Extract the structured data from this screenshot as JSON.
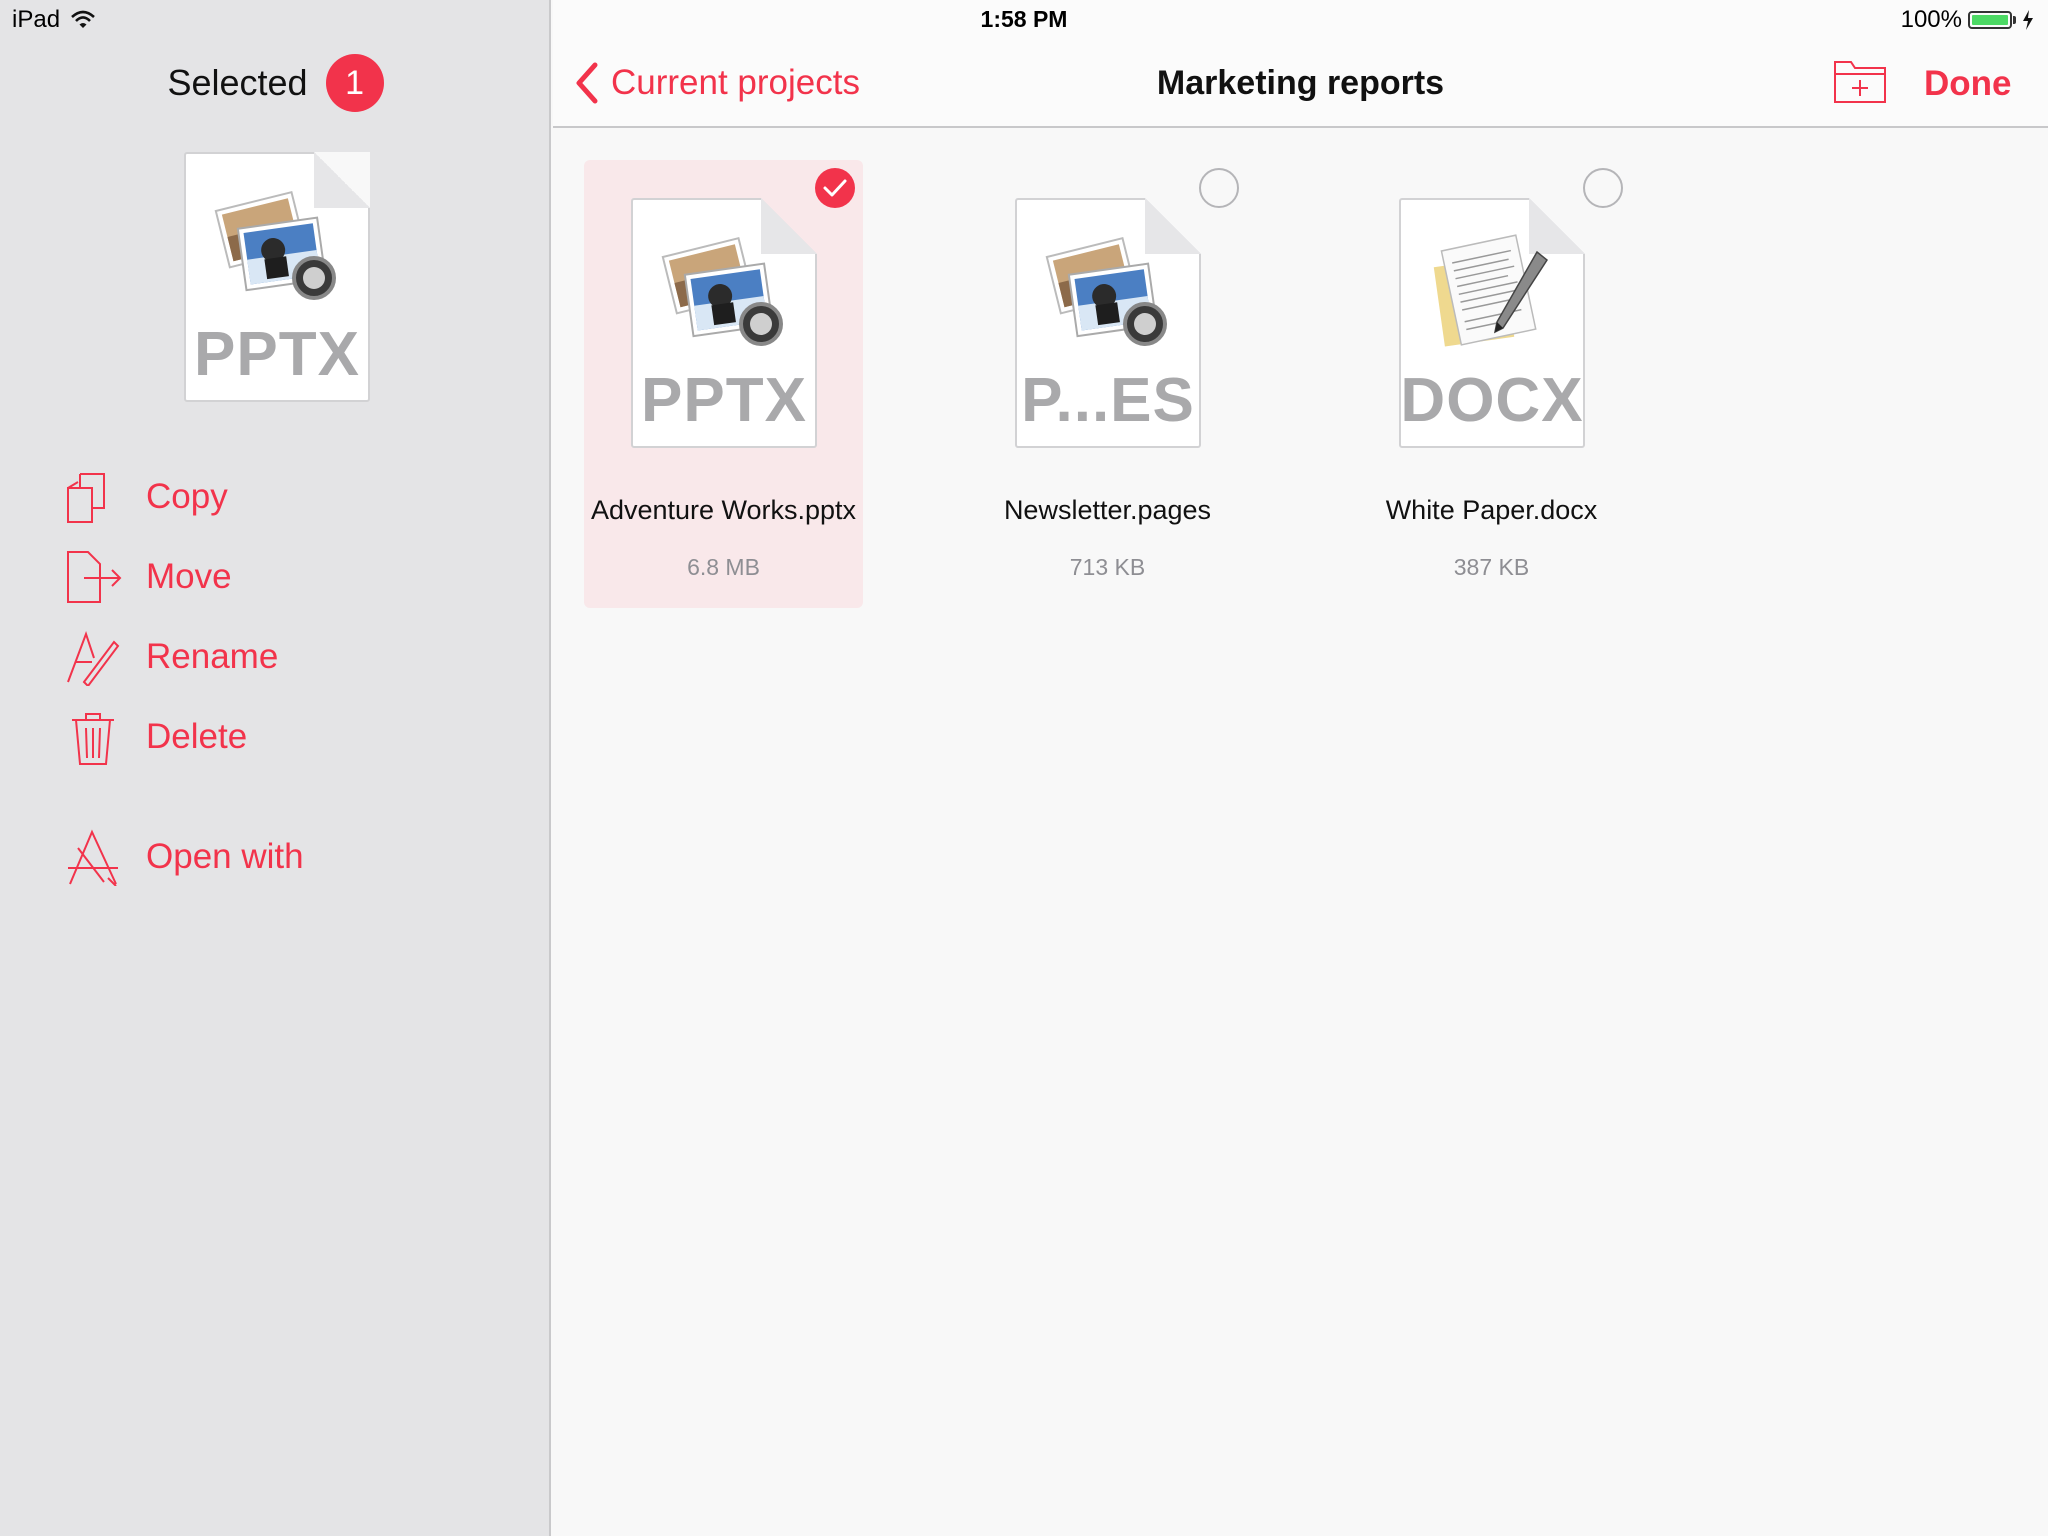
{
  "status_bar": {
    "device": "iPad",
    "time": "1:58 PM",
    "battery": "100%",
    "battery_level": 1.0
  },
  "sidebar": {
    "title": "Selected",
    "count": "1",
    "thumbnail_label": "PPTX",
    "actions": [
      {
        "label": "Copy",
        "icon": "copy-icon"
      },
      {
        "label": "Move",
        "icon": "move-icon"
      },
      {
        "label": "Rename",
        "icon": "rename-icon"
      },
      {
        "label": "Delete",
        "icon": "trash-icon"
      },
      {
        "label": "Open with",
        "icon": "app-store-icon"
      }
    ]
  },
  "navbar": {
    "back_label": "Current projects",
    "title": "Marketing reports",
    "done_label": "Done"
  },
  "files": [
    {
      "name": "Adventure Works.pptx",
      "size": "6.8 MB",
      "type_label": "PPTX",
      "icon": "preview-image-icon",
      "selected": true
    },
    {
      "name": "Newsletter.pages",
      "size": "713 KB",
      "type_label": "P...ES",
      "icon": "preview-image-icon",
      "selected": false
    },
    {
      "name": "White Paper.docx",
      "size": "387 KB",
      "type_label": "DOCX",
      "icon": "text-document-icon",
      "selected": false
    }
  ],
  "colors": {
    "accent": "#f2334b",
    "sidebar_bg": "#e4e4e6",
    "selected_tile_bg": "#f9e8ea"
  }
}
